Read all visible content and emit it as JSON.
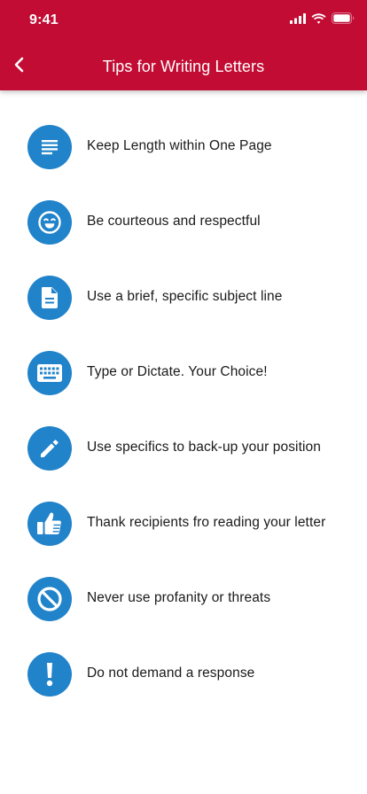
{
  "status_bar": {
    "time": "9:41"
  },
  "nav": {
    "title": "Tips for Writing Letters"
  },
  "colors": {
    "header": "#C20C33",
    "icon_circle": "#2183CA",
    "text": "#1a1a1a"
  },
  "tips": [
    {
      "label": "Keep Length within One Page",
      "icon": "text-lines-icon"
    },
    {
      "label": "Be courteous and respectful",
      "icon": "smiley-face-icon"
    },
    {
      "label": "Use a brief, specific subject line",
      "icon": "document-icon"
    },
    {
      "label": "Type or Dictate. Your Choice!",
      "icon": "keyboard-icon"
    },
    {
      "label": "Use specifics to back-up your position",
      "icon": "pencil-icon"
    },
    {
      "label": "Thank recipients fro reading your letter",
      "icon": "thumbs-up-icon"
    },
    {
      "label": "Never use profanity or threats",
      "icon": "prohibited-icon"
    },
    {
      "label": "Do not demand a response",
      "icon": "exclamation-icon"
    }
  ]
}
